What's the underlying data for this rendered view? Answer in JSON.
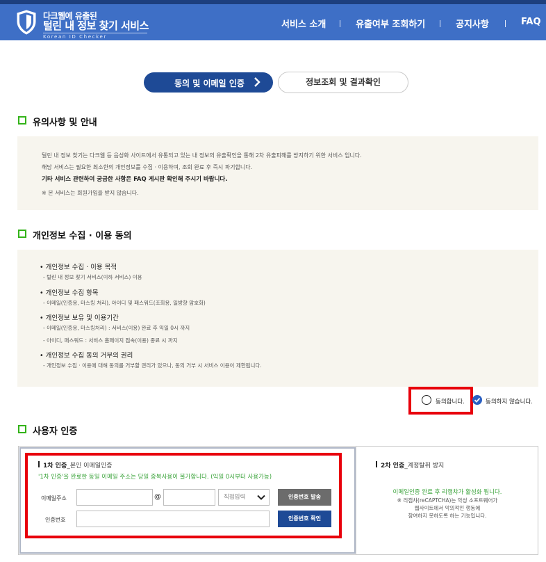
{
  "header": {
    "logo_small": "다크웹에 유출된",
    "logo_big": "털린 내 정보 찾기 서비스",
    "logo_sub": "Korean ID Checker",
    "nav": [
      "서비스 소개",
      "유출여부 조회하기",
      "공지사항",
      "FAQ"
    ]
  },
  "steps": {
    "step1": "동의 및 이메일 인증",
    "step2": "정보조회 및 결과확인"
  },
  "notice": {
    "title": "유의사항 및 안내",
    "line1": "털린 내 정보 찾기는 다크웹 등 음성화 사이트에서 유통되고 있는 내 정보의 유출확인을 통해 2차 유출피해를 방지하기 위한 서비스 입니다.",
    "line2": "해당 서비스는 필요한 최소한의 개인정보를 수집 · 이용하며, 조회 완료 후 즉시 파기합니다.",
    "line3": "기타 서비스 관련하여 궁금한 사항은 FAQ 게시판 확인해 주시기 바랍니다.",
    "line4": "※ 본 서비스는 회원가입을 받지 않습니다."
  },
  "consent": {
    "title": "개인정보 수집 · 이용 동의",
    "purpose_head": "• 개인정보 수집 · 이용 목적",
    "purpose_sub": "- 털린 내 정보 찾기 서비스(이하 서비스) 이용",
    "items_head": "• 개인정보 수집 항목",
    "items_sub": "- 이메일(인증용, 마스킹 처리), 아이디 및 패스워드(조회용, 일방향 암호화)",
    "retention_head": "• 개인정보 보유 및 이용기간",
    "retention_sub1": "- 이메일(인증용, 마스킹처리) : 서비스(이용) 완료 후 익일 0시 까지",
    "retention_sub2": "- 아이디, 패스워드 : 서비스 홈페이지 접속(이용) 종료 시 까지",
    "refuse_head": "• 개인정보 수집 동의 거부의 권리",
    "refuse_sub": "- 개인정보 수집 · 이용에 대해 동의를 거부할 권리가 있으나, 동의 거부 시 서비스 이용이 제한됩니다.",
    "agree_label": "동의합니다.",
    "disagree_label": "동의하지 않습니다."
  },
  "auth": {
    "title": "사용자 인증",
    "first_title": "1차 인증",
    "first_title_sub": "_본인 이메일인증",
    "first_notice": "'1차 인증'을 완료한 동일 이메일 주소는 당일 중복사용이 불가합니다. (익일 0시부터 사용가능)",
    "email_label": "이메일주소",
    "at_sign": "@",
    "domain_select": "직접입력",
    "send_button": "인증번호 발송",
    "code_label": "인증번호",
    "confirm_button": "인증번호 확인",
    "second_title": "2차 인증",
    "second_title_sub": "_계정탈취 방지",
    "second_green": "이메일인증 완료 후 리캡챠가 활성화 됩니다.",
    "second_line1": "※ 리캡챠(reCAPTCHA)는 악성 소프트웨어가",
    "second_line2": "웹사이트에서 악의적인 행동에",
    "second_line3": "참여하지 못하도록 하는 기능입니다."
  },
  "colors": {
    "header_bg": "#3e6fc6",
    "primary": "#1e4a96",
    "section_marker": "#33b319",
    "highlight_border": "#e8000b",
    "green_text": "#3aa33a"
  }
}
